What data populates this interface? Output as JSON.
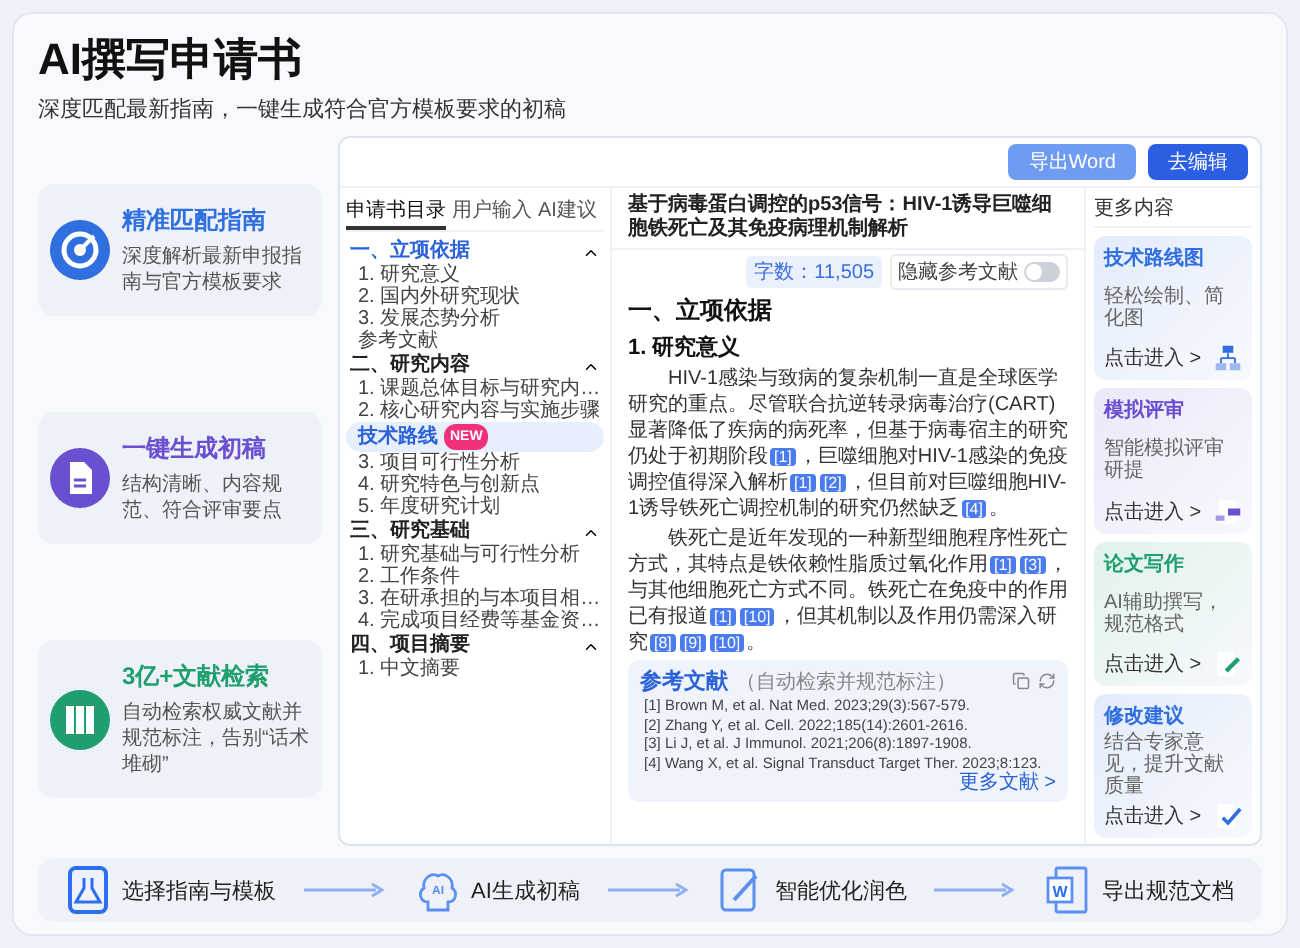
{
  "header": {
    "title": "AI撰写申请书",
    "subtitle": "深度匹配最新指南，一键生成符合官方模板要求的初稿"
  },
  "features": [
    {
      "kind": "target",
      "title": "精准匹配指南",
      "description": "深度解析最新申报指南与官方模板要求",
      "color": "#2f6fe0"
    },
    {
      "kind": "document",
      "title": "一键生成初稿",
      "description": "结构清晰、内容规范、符合评审要点",
      "color": "#6a4fd0"
    },
    {
      "kind": "books",
      "title": "3亿+文献检索",
      "description": "自动检索权威文献并规范标注，告别“话术堆砌”",
      "color": "#1f9e6e"
    }
  ],
  "toolbar": {
    "buttons": [
      {
        "label": "导出Word",
        "primary": false
      },
      {
        "label": "去编辑",
        "primary": true
      }
    ]
  },
  "sidebar": {
    "tabs": [
      {
        "label": "申请书目录",
        "selected": true
      },
      {
        "label": "用户输入",
        "selected": false
      },
      {
        "label": "AI建议",
        "selected": false
      }
    ],
    "sections": [
      {
        "label": "一、立项依据",
        "current": true,
        "expanded": true,
        "children": [
          {
            "label": "1. 研究意义",
            "selected": false
          },
          {
            "label": "2. 国内外研究现状",
            "selected": false
          },
          {
            "label": "3. 发展态势分析",
            "selected": false
          },
          {
            "label": "参考文献",
            "selected": false
          }
        ]
      },
      {
        "label": "二、研究内容",
        "current": false,
        "expanded": true,
        "children": [
          {
            "label": "1. 课题总体目标与研究内…",
            "selected": false
          },
          {
            "label": "2. 核心研究内容与实施步骤",
            "selected": false
          },
          {
            "label": "技术路线",
            "selected": true,
            "badge": "NEW"
          },
          {
            "label": "3. 项目可行性分析",
            "selected": false
          },
          {
            "label": "4. 研究特色与创新点",
            "selected": false
          },
          {
            "label": "5. 年度研究计划",
            "selected": false
          }
        ]
      },
      {
        "label": "三、研究基础",
        "current": false,
        "expanded": true,
        "children": [
          {
            "label": "1. 研究基础与可行性分析",
            "selected": false
          },
          {
            "label": "2. 工作条件",
            "selected": false
          },
          {
            "label": "3. 在研承担的与本项目相…",
            "selected": false
          },
          {
            "label": "4. 完成项目经费等基金资…",
            "selected": false
          }
        ]
      },
      {
        "label": "四、项目摘要",
        "current": false,
        "expanded": true,
        "children": [
          {
            "label": "1. 中文摘要",
            "selected": false
          }
        ]
      }
    ]
  },
  "document": {
    "title": "基于病毒蛋白调控的p53信号：HIV-1诱导巨噬细胞铁死亡及其免疫病理机制解析",
    "word_count": "字数：11,505",
    "hide_references": {
      "label": "隐藏参考文献",
      "on": false
    },
    "heading": "一、立项依据",
    "subheading": "1. 研究意义",
    "paragraphs": [
      [
        {
          "kind": "text",
          "text": "HIV-1感染与致病的复杂机制一直是全球医学研究的重点。尽管联合抗逆转录病毒治疗(CART)显著降低了疾病的病死率，但基于病毒宿主的研究仍处于初期阶段"
        },
        {
          "kind": "cite",
          "text": "[1]"
        },
        {
          "kind": "text",
          "text": "，巨噬细胞对HIV-1感染的免疫调控值得深入解析"
        },
        {
          "kind": "cite",
          "text": "[1]"
        },
        {
          "kind": "cite",
          "text": "[2]"
        },
        {
          "kind": "text",
          "text": "，但目前对巨噬细胞HIV-1诱导铁死亡调控机制的研究仍然缺乏"
        },
        {
          "kind": "cite",
          "text": "[4]"
        },
        {
          "kind": "text",
          "text": "。"
        }
      ],
      [
        {
          "kind": "text",
          "text": "铁死亡是近年发现的一种新型细胞程序性死亡方式，其特点是铁依赖性脂质过氧化作用"
        },
        {
          "kind": "cite",
          "text": "[1]"
        },
        {
          "kind": "cite",
          "text": "[3]"
        },
        {
          "kind": "text",
          "text": "，与其他细胞死亡方式不同。铁死亡在免疫中的作用已有报道"
        },
        {
          "kind": "cite",
          "text": "[1]"
        },
        {
          "kind": "cite",
          "text": "[10]"
        },
        {
          "kind": "text",
          "text": "，但其机制以及作用仍需深入研究"
        },
        {
          "kind": "cite",
          "text": "[8]"
        },
        {
          "kind": "cite",
          "text": "[9]"
        },
        {
          "kind": "cite",
          "text": "[10]"
        },
        {
          "kind": "text",
          "text": "。"
        }
      ]
    ],
    "references": {
      "title": "参考文献",
      "note": "（自动检索并规范标注）",
      "items": [
        {
          "number": "[1]",
          "text": "Brown M, et al. Nat Med. 2023;29(3):567-579."
        },
        {
          "number": "[2]",
          "text": "Zhang Y, et al. Cell. 2022;185(14):2601-2616."
        },
        {
          "number": "[3]",
          "text": "Li J, et al. J Immunol. 2021;206(8):1897-1908."
        },
        {
          "number": "[4]",
          "text": "Wang X, et al. Signal Transduct Target Ther. 2023;8:123."
        }
      ],
      "more": "更多文献 >"
    }
  },
  "more_panel": {
    "title": "更多内容",
    "cards": [
      {
        "kind": "diagram",
        "title": "技术路线图",
        "description": "轻松绘制、简化图",
        "link": "点击进入 >",
        "color": "#2f6fe0"
      },
      {
        "kind": "review",
        "title": "模拟评审",
        "description": "智能模拟评审研提",
        "link": "点击进入 >",
        "color": "#6a4fd0"
      },
      {
        "kind": "writing",
        "title": "论文写作",
        "description": "AI辅助撰写，规范格式",
        "link": "点击进入 >",
        "color": "#1f9e6e"
      },
      {
        "kind": "revision",
        "title": "修改建议",
        "description": "结合专家意见，提升文献质量",
        "link": "点击进入 >",
        "color": "#2f6fe0"
      }
    ]
  },
  "steps": [
    {
      "kind": "template",
      "label": "选择指南与模板"
    },
    {
      "kind": "ai",
      "icon_text": "AI",
      "label": "AI生成初稿"
    },
    {
      "kind": "polish",
      "label": "智能优化润色"
    },
    {
      "kind": "word",
      "icon_text": "W",
      "label": "导出规范文档"
    }
  ]
}
